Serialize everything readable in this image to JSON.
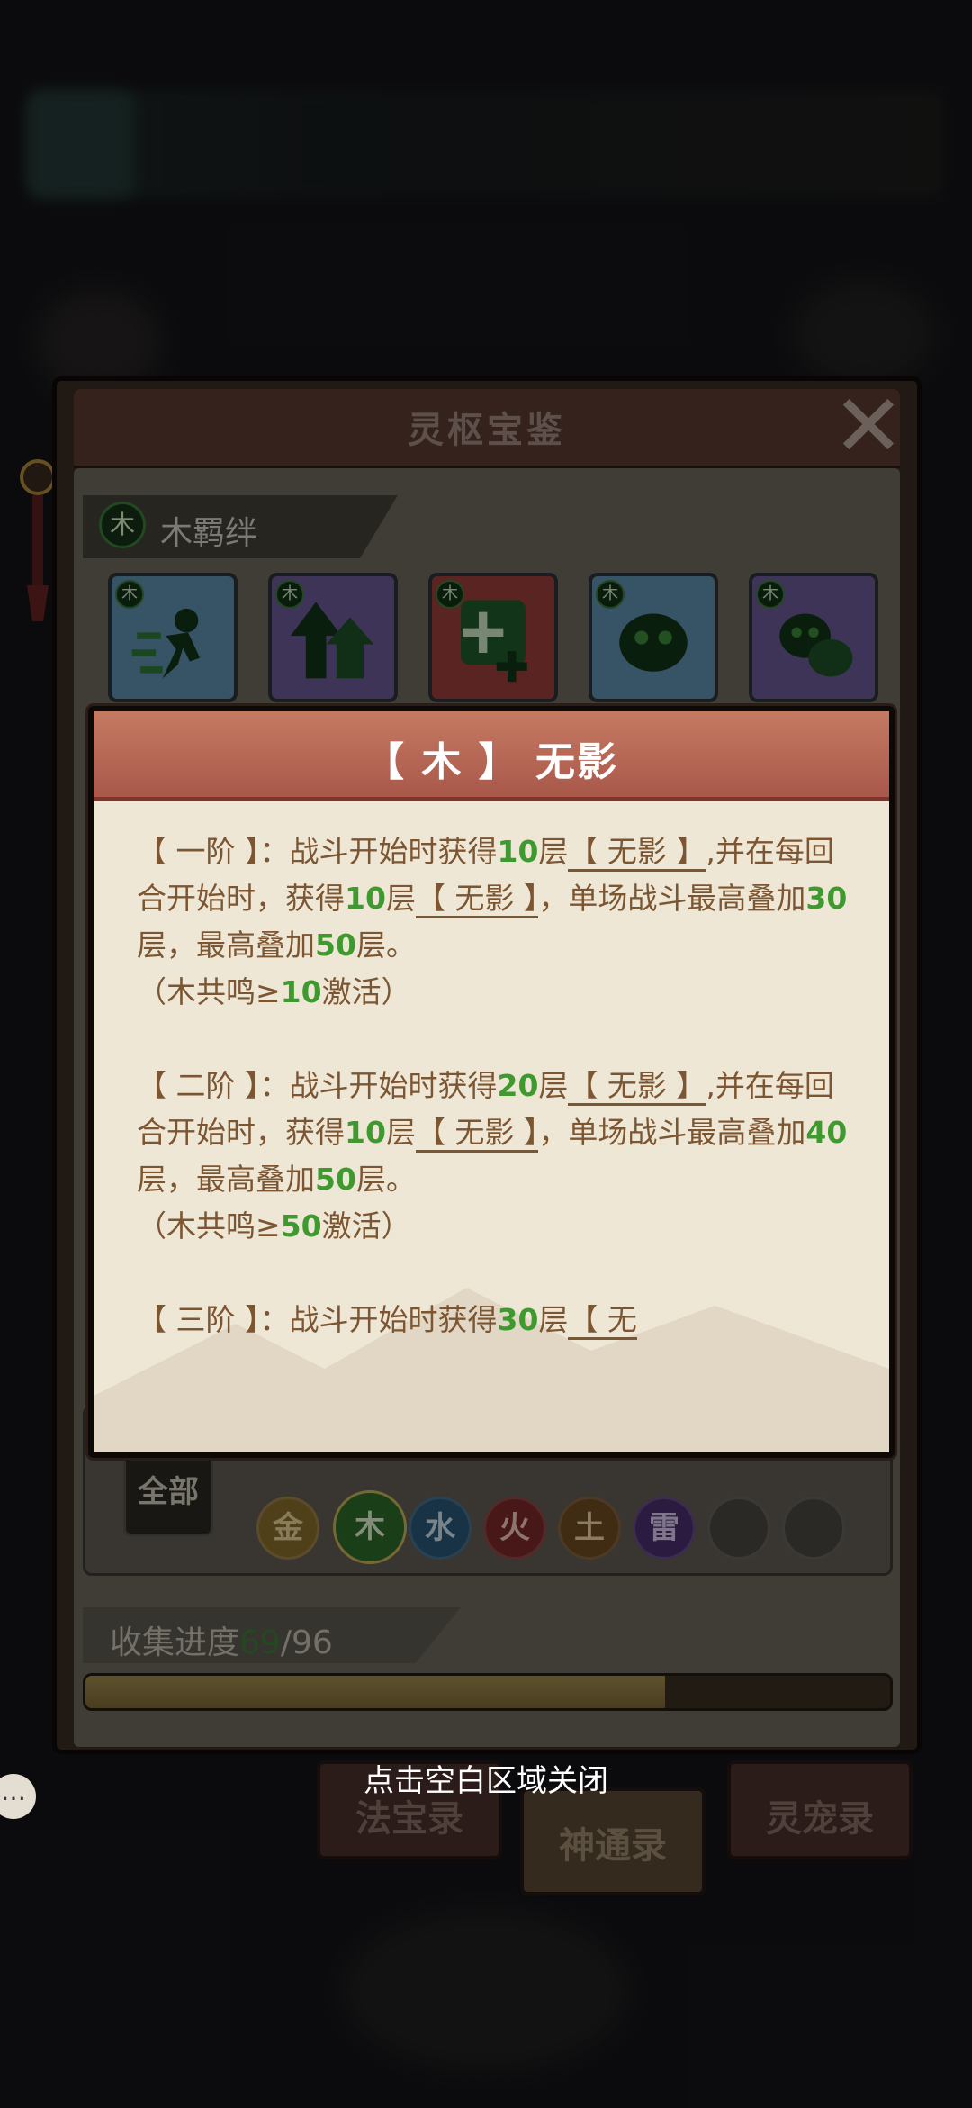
{
  "panel": {
    "title": "灵枢宝鉴",
    "bond_element": "木",
    "bond_label": "木羁绊",
    "cards": [
      {
        "element": "木",
        "icon": "running-figure-icon",
        "frame": "blue"
      },
      {
        "element": "木",
        "icon": "arrows-up-icon",
        "frame": "purple"
      },
      {
        "element": "木",
        "icon": "plus-burst-icon",
        "frame": "red"
      },
      {
        "element": "木",
        "icon": "poison-blob-icon",
        "frame": "blue"
      },
      {
        "element": "木",
        "icon": "poison-cluster-icon",
        "frame": "purple"
      }
    ]
  },
  "filter": {
    "all_label": "全部",
    "elements": [
      {
        "label": "金",
        "color": "#8a6f2c"
      },
      {
        "label": "木",
        "color": "#2e6b2a"
      },
      {
        "label": "水",
        "color": "#2a5878"
      },
      {
        "label": "火",
        "color": "#7c2a2a"
      },
      {
        "label": "土",
        "color": "#6e4a22"
      },
      {
        "label": "雷",
        "color": "#4c2f6e"
      }
    ]
  },
  "progress": {
    "label": "收集进度",
    "current": "69",
    "total": "/96",
    "fraction": 0.72
  },
  "tabs": [
    {
      "label": "法宝录",
      "active": false
    },
    {
      "label": "神通录",
      "active": true
    },
    {
      "label": "灵宠录",
      "active": false
    }
  ],
  "hint": "点击空白区域关闭",
  "modal": {
    "title": "【 木 】 无影",
    "tier1": {
      "t1": "【 一阶 】：战斗开始时获得",
      "n1": "10",
      "t2": "层",
      "u1": "【 无影 】",
      "t3": ",并在每回合开始时，获得",
      "n2": "10",
      "t4": "层",
      "u2": "【 无影 】",
      "t5": "，单场战斗最高叠加",
      "n3": "30",
      "t6": "层，最高叠加",
      "n4": "50",
      "t7": "层。",
      "cond_pre": "（木共鸣≥",
      "cond_num": "10",
      "cond_post": "激活）"
    },
    "tier2": {
      "t1": "【 二阶 】：战斗开始时获得",
      "n1": "20",
      "t2": "层",
      "u1": "【 无影 】",
      "t3": ",并在每回合开始时，获得",
      "n2": "10",
      "t4": "层",
      "u2": "【 无影 】",
      "t5": "，单场战斗最高叠加",
      "n3": "40",
      "t6": "层，最高叠加",
      "n4": "50",
      "t7": "层。",
      "cond_pre": "（木共鸣≥",
      "cond_num": "50",
      "cond_post": "激活）"
    },
    "tier3": {
      "t1": "【 三阶 】：战斗开始时获得",
      "n1": "30",
      "t2": "层",
      "u1": "【 无"
    }
  }
}
